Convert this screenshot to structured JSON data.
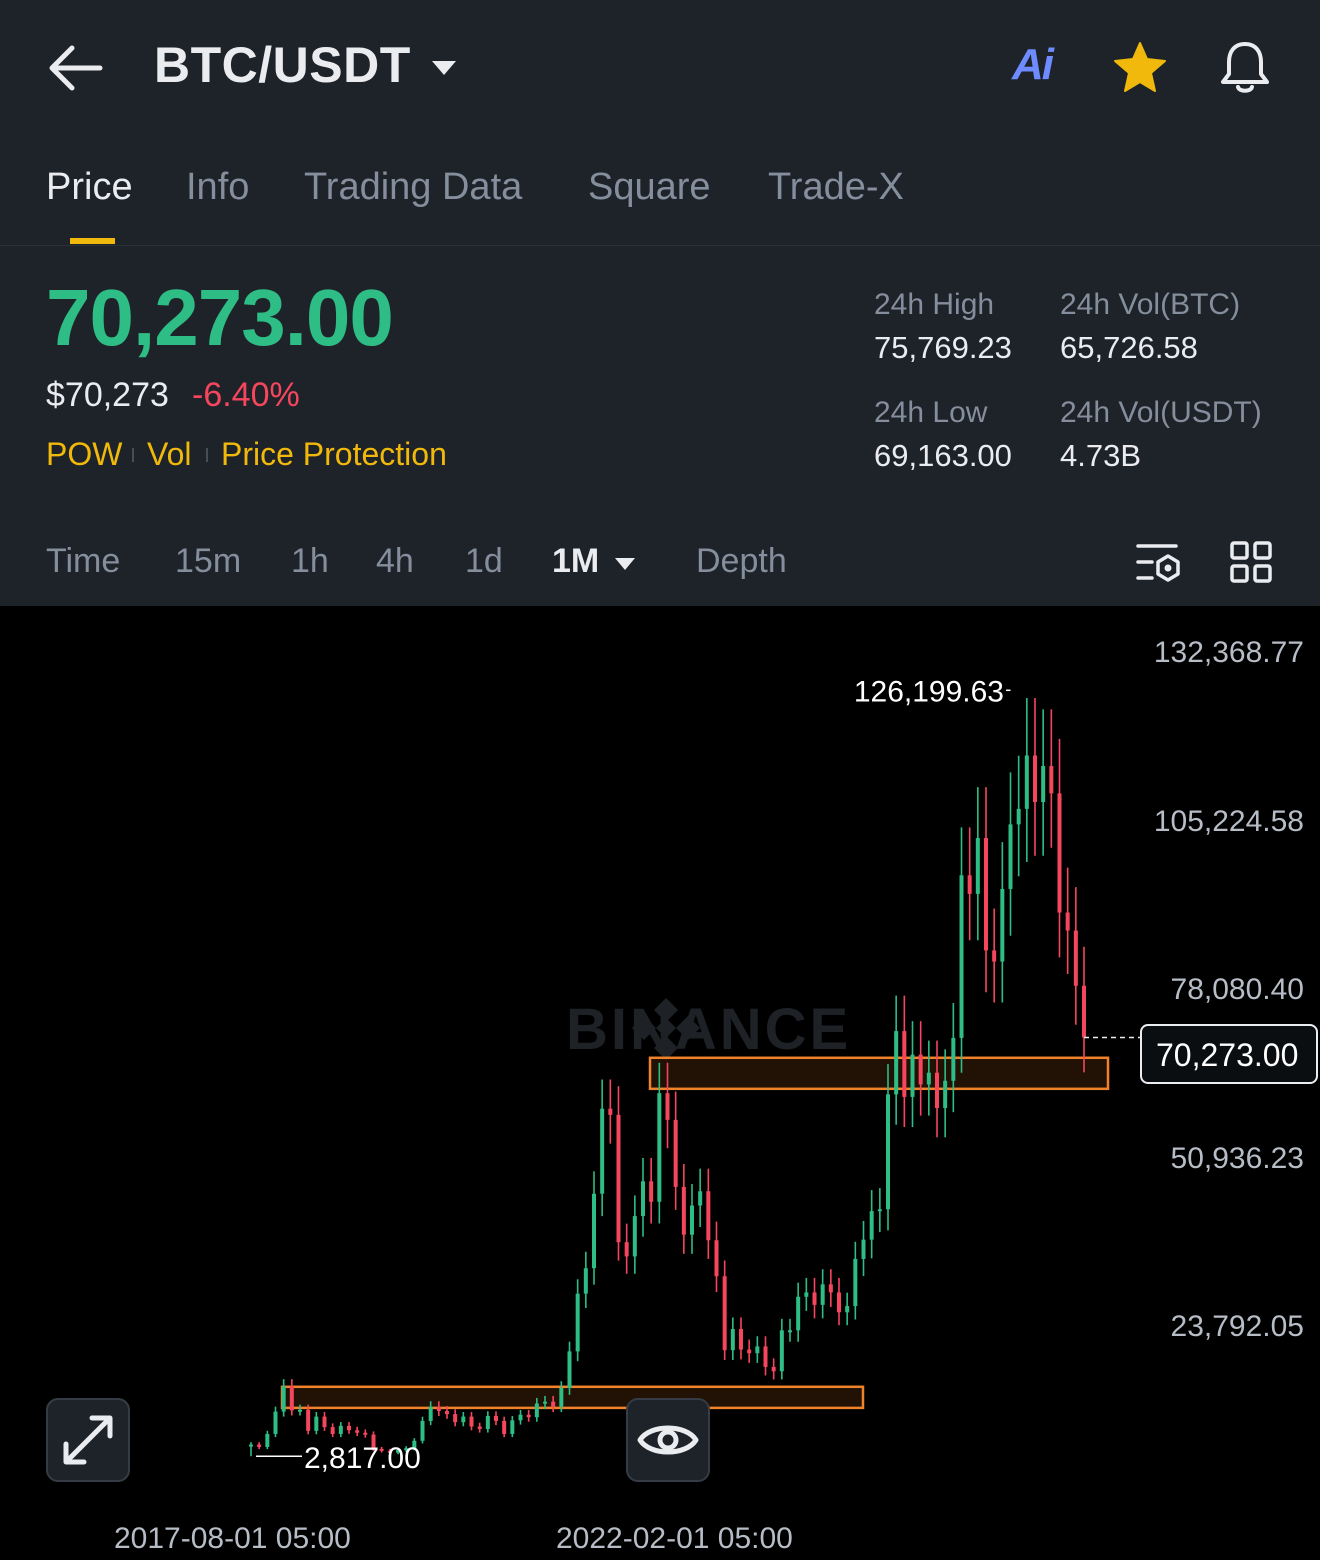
{
  "header": {
    "pair": "BTC/USDT",
    "ai_label": "Ai",
    "icons": {
      "back": "arrow-left-icon",
      "caret": "caret-down-icon",
      "favorite": "star-icon",
      "alerts": "bell-icon"
    },
    "colors": {
      "favorite": "#F0B90B",
      "ai": "#6E8BFF"
    }
  },
  "tabs": [
    {
      "label": "Price",
      "active": true
    },
    {
      "label": "Info"
    },
    {
      "label": "Trading Data"
    },
    {
      "label": "Square"
    },
    {
      "label": "Trade-X"
    }
  ],
  "ticker": {
    "last_price": "70,273.00",
    "usd_price": "$70,273",
    "change_pct": "-6.40%",
    "tags": [
      "POW",
      "Vol",
      "Price Protection"
    ],
    "stats": {
      "high_label": "24h High",
      "high_value": "75,769.23",
      "vol_btc_label": "24h Vol(BTC)",
      "vol_btc_value": "65,726.58",
      "low_label": "24h Low",
      "low_value": "69,163.00",
      "vol_usdt_label": "24h Vol(USDT)",
      "vol_usdt_value": "4.73B"
    },
    "colors": {
      "up": "#2EBD85",
      "down": "#F6465D",
      "accent": "#F0B90B"
    }
  },
  "timeframes": {
    "items": [
      "Time",
      "15m",
      "1h",
      "4h",
      "1d",
      "1M",
      "Depth"
    ],
    "active": "1M",
    "tool_icons": [
      "chart-settings-icon",
      "grid-layout-icon"
    ]
  },
  "chart": {
    "watermark": "BINANCE",
    "floating_buttons": [
      "expand-icon",
      "eye-icon"
    ]
  },
  "chart_data": {
    "type": "candlestick",
    "interval": "1M",
    "y_ticks": [
      "132,368.77",
      "105,224.58",
      "78,080.40",
      "50,936.23",
      "23,792.05"
    ],
    "y_tick_values": [
      132368.77,
      105224.58,
      78080.4,
      50936.23,
      23792.05
    ],
    "x_ticks": [
      "2017-08-01 05:00",
      "2022-02-01 05:00"
    ],
    "current_price": "70,273.00",
    "current_price_value": 70273.0,
    "annotations": {
      "max_label": "126,199.63",
      "max_value": 126199.63,
      "min_label": "2,817.00",
      "min_value": 2817.0
    },
    "zones": [
      {
        "low": 10600,
        "high": 14000,
        "color": "#F0822A"
      },
      {
        "low": 62000,
        "high": 67000,
        "color": "#F0822A"
      }
    ],
    "closes": [
      4700,
      4300,
      6400,
      10000,
      14100,
      10200,
      10300,
      6900,
      9200,
      7500,
      6400,
      7700,
      7000,
      6600,
      6300,
      4000,
      3700,
      3400,
      3800,
      4100,
      5300,
      8500,
      10800,
      10100,
      9600,
      8300,
      9200,
      7600,
      7200,
      9300,
      8500,
      6400,
      8600,
      9500,
      9100,
      11300,
      11600,
      10800,
      13800,
      19700,
      29000,
      33100,
      45100,
      58800,
      57800,
      37300,
      35000,
      41500,
      47100,
      43800,
      61300,
      57000,
      46200,
      38500,
      43200,
      45500,
      37600,
      31800,
      19900,
      23300,
      20000,
      19400,
      20500,
      17200,
      16500,
      23100,
      23100,
      28500,
      29200,
      27200,
      30500,
      29200,
      26000,
      27000,
      34600,
      37700,
      42300,
      42600,
      61100,
      71300,
      60700,
      67500,
      62700,
      64600,
      58900,
      63300,
      70200,
      96400,
      93400,
      102400,
      84300,
      82500,
      94200,
      104600,
      107100,
      115700,
      108200,
      114000,
      109600,
      90400,
      87500,
      78600,
      70273
    ]
  }
}
